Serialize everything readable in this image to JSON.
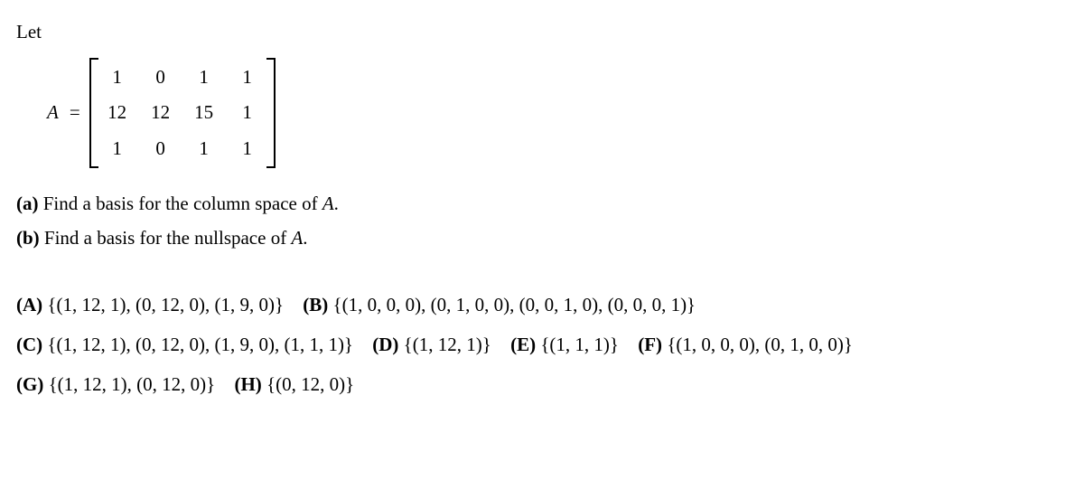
{
  "intro": "Let",
  "matrix": {
    "label": "A",
    "equals": "=",
    "rows": [
      [
        "1",
        "0",
        "1",
        "1"
      ],
      [
        "12",
        "12",
        "15",
        "1"
      ],
      [
        "1",
        "0",
        "1",
        "1"
      ]
    ]
  },
  "parts": {
    "a": {
      "label": "(a)",
      "text_before": "Find a basis for the column space of ",
      "var": "A",
      "text_after": "."
    },
    "b": {
      "label": "(b)",
      "text_before": "Find a basis for the nullspace of ",
      "var": "A",
      "text_after": "."
    }
  },
  "choices": {
    "A": {
      "label": "(A)",
      "text": "{(1, 12, 1), (0, 12, 0), (1, 9, 0)}"
    },
    "B": {
      "label": "(B)",
      "text": "{(1, 0, 0, 0), (0, 1, 0, 0), (0, 0, 1, 0), (0, 0, 0, 1)}"
    },
    "C": {
      "label": "(C)",
      "text": "{(1, 12, 1), (0, 12, 0), (1, 9, 0), (1, 1, 1)}"
    },
    "D": {
      "label": "(D)",
      "text": "{(1, 12, 1)}"
    },
    "E": {
      "label": "(E)",
      "text": "{(1, 1, 1)}"
    },
    "F": {
      "label": "(F)",
      "text": "{(1, 0, 0, 0), (0, 1, 0, 0)}"
    },
    "G": {
      "label": "(G)",
      "text": "{(1, 12, 1), (0, 12, 0)}"
    },
    "H": {
      "label": "(H)",
      "text": "{(0, 12, 0)}"
    }
  }
}
